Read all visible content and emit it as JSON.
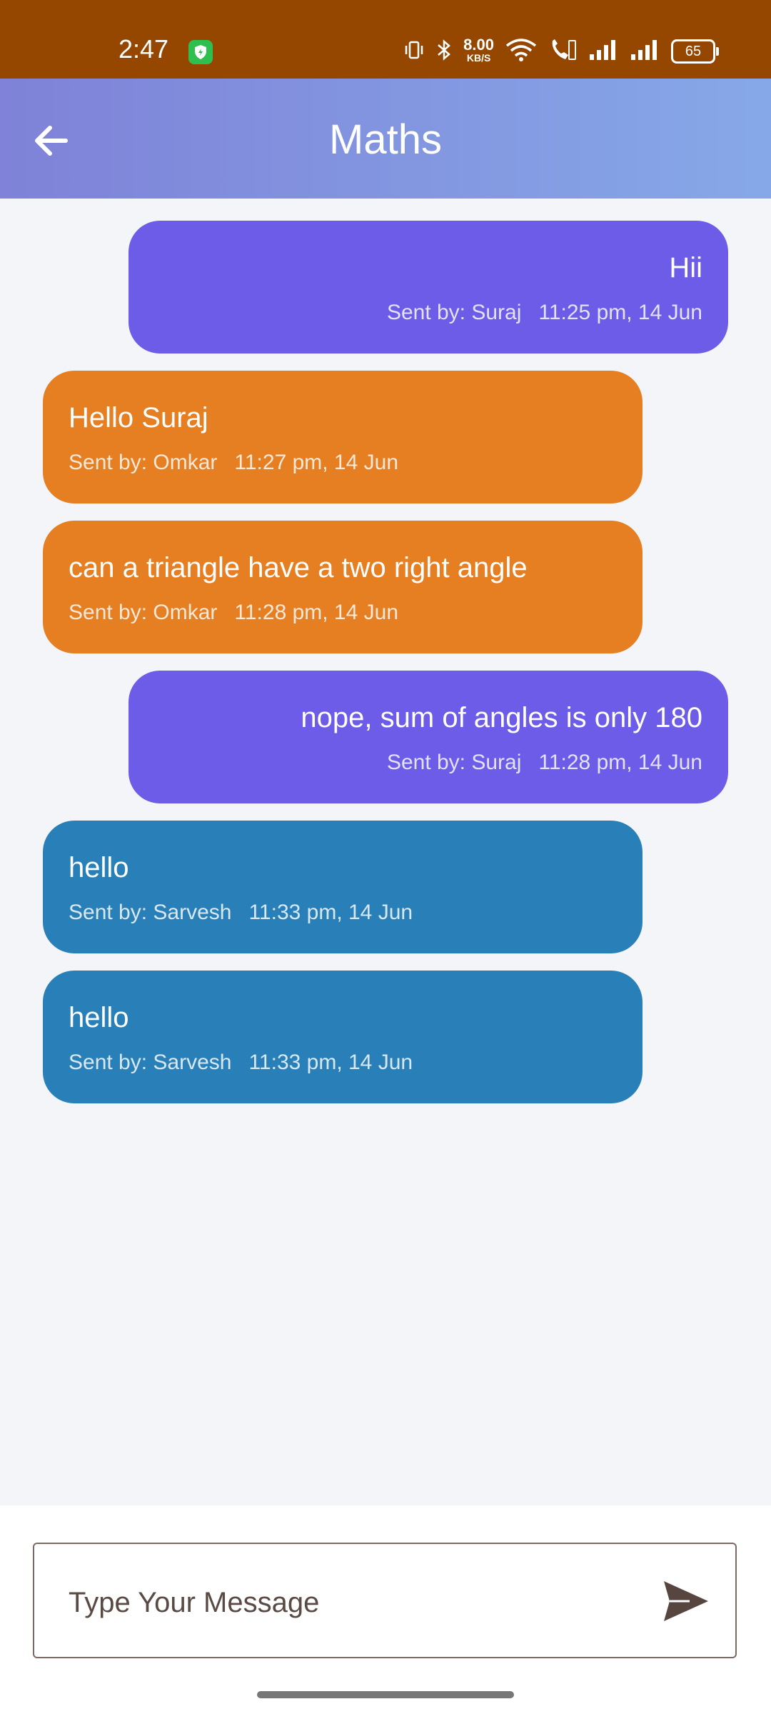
{
  "status": {
    "time": "2:47",
    "net_speed_value": "8.00",
    "net_speed_unit": "KB/S",
    "battery": "65"
  },
  "header": {
    "title": "Maths"
  },
  "messages": [
    {
      "text": "Hii",
      "sender": "Sent by: Suraj",
      "time": "11:25 pm, 14 Jun",
      "side": "right",
      "color": "#6c5ce7"
    },
    {
      "text": "Hello Suraj",
      "sender": "Sent by: Omkar",
      "time": "11:27 pm, 14 Jun",
      "side": "left",
      "color": "#e67e22"
    },
    {
      "text": "can a triangle have a two right angle",
      "sender": "Sent by: Omkar",
      "time": "11:28 pm, 14 Jun",
      "side": "left",
      "color": "#e67e22"
    },
    {
      "text": "nope, sum of angles is only 180",
      "sender": "Sent by: Suraj",
      "time": "11:28 pm, 14 Jun",
      "side": "right",
      "color": "#6c5ce7"
    },
    {
      "text": "hello",
      "sender": "Sent by: Sarvesh",
      "time": "11:33 pm, 14 Jun",
      "side": "left",
      "color": "#2980b9"
    },
    {
      "text": "hello",
      "sender": "Sent by: Sarvesh",
      "time": "11:33 pm, 14 Jun",
      "side": "left",
      "color": "#2980b9"
    }
  ],
  "composer": {
    "placeholder": "Type Your Message",
    "send_icon": "send-icon"
  }
}
